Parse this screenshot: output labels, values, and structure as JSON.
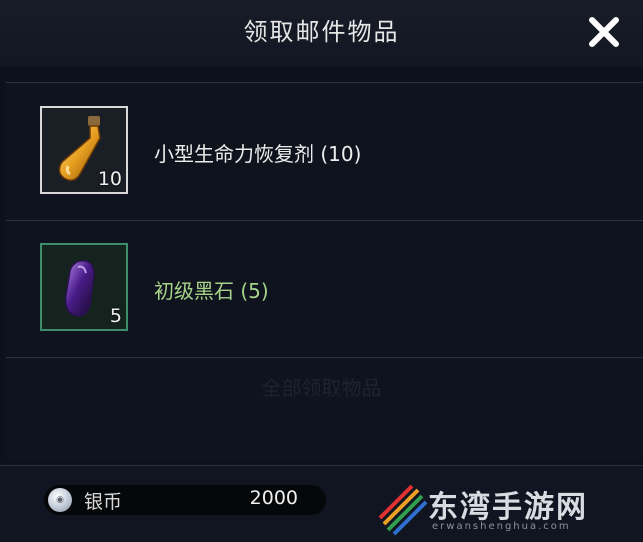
{
  "dialog": {
    "title": "领取邮件物品",
    "close_icon": "close-icon"
  },
  "items": [
    {
      "name": "小型生命力恢复剂 (10)",
      "quantity": "10",
      "icon": "potion-bottle-icon",
      "rarity_color": "#d9d9d9"
    },
    {
      "name": "初级黑石 (5)",
      "quantity": "5",
      "icon": "black-stone-icon",
      "rarity_color": "#3e8c6a"
    }
  ],
  "faded_text": "全部领取物品",
  "currency": {
    "icon": "silver-coin-icon",
    "label": "银币",
    "value": "2000"
  },
  "watermark": {
    "brand": "东湾手游网",
    "sub": "erwanshenghua.com"
  }
}
